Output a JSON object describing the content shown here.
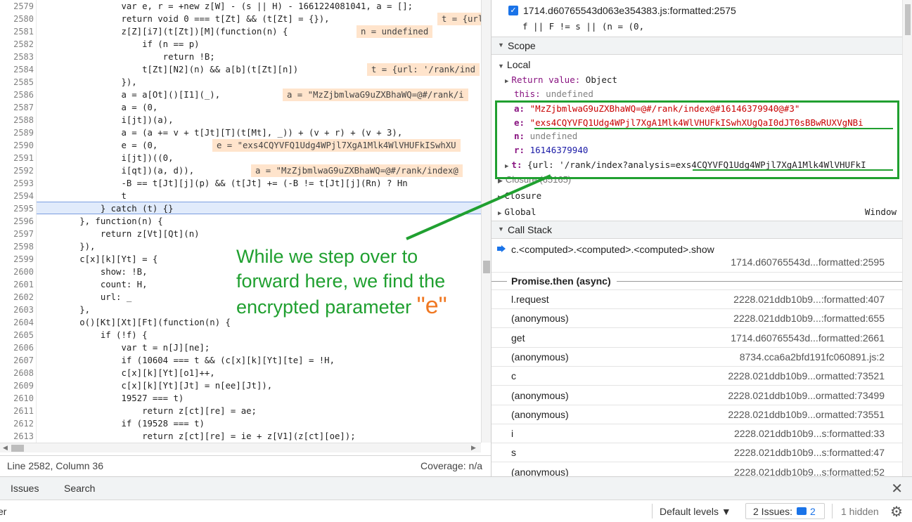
{
  "code": {
    "line_numbers": [
      "2579",
      "2580",
      "2581",
      "2582",
      "2583",
      "2584",
      "2585",
      "2586",
      "2587",
      "2588",
      "2589",
      "2590",
      "2591",
      "2592",
      "2593",
      "2594",
      "2595",
      "2596",
      "2597",
      "2598",
      "2599",
      "2600",
      "2601",
      "2602",
      "2603",
      "2604",
      "2605",
      "2606",
      "2607",
      "2608",
      "2609",
      "2610",
      "2611",
      "2612",
      "2613"
    ],
    "lines": [
      "                var e, r = +new z[W] - (s || H) - 1661224081041, a = [];",
      "                return void 0 === t[Zt] && (t[Zt] = {}),",
      "                z[Z][i7](t[Zt])[M](function(n) {",
      "                    if (n == p)",
      "                        return !B;",
      "                    t[Zt][N2](n) && a[b](t[Zt][n])",
      "                }),",
      "                a = a[Ot]()[I1](_),",
      "                a = (0,",
      "                i[jt])(a),",
      "                a = (a += v + t[Jt][T](t[Mt], _)) + (v + r) + (v + 3),",
      "                e = (0,",
      "                i[jt])((0,",
      "                i[qt])(a, d)),",
      "                -B == t[Jt][j](p) && (t[Jt] += (-B != t[Jt][j](Rn) ? Hn",
      "                t",
      "            } catch (t) {}",
      "        }, function(n) {",
      "            return z[Vt][Qt](n)",
      "        }),",
      "        c[x][k][Yt] = {",
      "            show: !B,",
      "            count: H,",
      "            url: _",
      "        },",
      "        o()[Kt][Xt][Ft](function(n) {",
      "            if (!f) {",
      "                var t = n[J][ne];",
      "                if (10604 === t && (c[x][k][Yt][te] = !H,",
      "                c[x][k][Yt][o1]++,",
      "                c[x][k][Yt][Jt] = n[ee][Jt]),",
      "                19527 === t)",
      "                    return z[ct][re] = ae;",
      "                if (19528 === t)",
      "                    return z[ct][re] = ie + z[V1](z[ct][oe]);"
    ],
    "inline_values": {
      "l2580": "t = {url: '/ra",
      "l2581": "n = undefined",
      "l2584": "t = {url: '/rank/ind",
      "l2586": "a = \"MzZjbmlwaG9uZXBhaWQ=@#/rank/i",
      "l2590": "e = \"exs4CQYVFQ1Udg4WPjl7XgA1Mlk4WlVHUFkISwhXU",
      "l2592": "a = \"MzZjbmlwaG9uZXBhaWQ=@#/rank/index@"
    }
  },
  "status": {
    "position": "Line 2582, Column 36",
    "coverage": "Coverage: n/a"
  },
  "breakpoint": {
    "label": "1714.d60765543d063e354383.js:formatted:2575",
    "code": "f || F != s || (n = (0,"
  },
  "scope": {
    "header": "Scope",
    "local_label": "Local",
    "return_key": "Return value:",
    "return_val": "Object",
    "this_key": "this:",
    "this_val": "undefined",
    "a_key": "a:",
    "a_val": "\"MzZjbmlwaG9uZXBhaWQ=@#/rank/index@#16146379940@#3\"",
    "e_key": "e:",
    "e_val": "\"exs4CQYVFQ1Udg4WPjl7XgA1Mlk4WlVHUFkISwhXUgQaI0dJT0sBBwRUXVgNBi",
    "n_key": "n:",
    "n_val": "undefined",
    "r_key": "r:",
    "r_val": "16146379940",
    "t_key": "t:",
    "t_val": "{url: '/rank/index?analysis=exs4CQYVFQ1Udg4WPjl7XgA1Mlk4WlVHUFkI",
    "closure1": "Closure (65165)",
    "closure2": "Closure",
    "global": "Global",
    "global_val": "Window"
  },
  "call_stack": {
    "header": "Call Stack",
    "active_fn": "c.<computed>.<computed>.<computed>.show",
    "active_loc": "1714.d60765543d...formatted:2595",
    "async_label": "Promise.then (async)",
    "frames": [
      {
        "fn": "l.request",
        "loc": "2228.021ddb10b9...:formatted:407"
      },
      {
        "fn": "(anonymous)",
        "loc": "2228.021ddb10b9...:formatted:655"
      },
      {
        "fn": "get",
        "loc": "1714.d60765543d...formatted:2661"
      },
      {
        "fn": "(anonymous)",
        "loc": "8734.cca6a2bfd191fc060891.js:2"
      },
      {
        "fn": "c",
        "loc": "2228.021ddb10b9...ormatted:73521"
      },
      {
        "fn": "(anonymous)",
        "loc": "2228.021ddb10b9...ormatted:73499"
      },
      {
        "fn": "(anonymous)",
        "loc": "2228.021ddb10b9...ormatted:73551"
      },
      {
        "fn": "i",
        "loc": "2228.021ddb10b9...s:formatted:33"
      },
      {
        "fn": "s",
        "loc": "2228.021ddb10b9...s:formatted:47"
      },
      {
        "fn": "(anonymous)",
        "loc": "2228.021ddb10b9...s:formatted:52"
      }
    ]
  },
  "drawer": {
    "tab_issues": "Issues",
    "tab_search": "Search",
    "close": "✕",
    "filter_text": "er",
    "default_levels": "Default levels ▼",
    "issues_label": "2 Issues:",
    "issues_count": "2",
    "hidden": "1 hidden",
    "settings_icon": "gear-icon"
  },
  "annotation": {
    "line1": "While we step over to",
    "line2": "forward here, we find the",
    "line3": "encrypted parameter",
    "accent": "\"e\"",
    "colors": {
      "text": "#20a030",
      "accent": "#f07822",
      "box": "#20a030"
    }
  }
}
